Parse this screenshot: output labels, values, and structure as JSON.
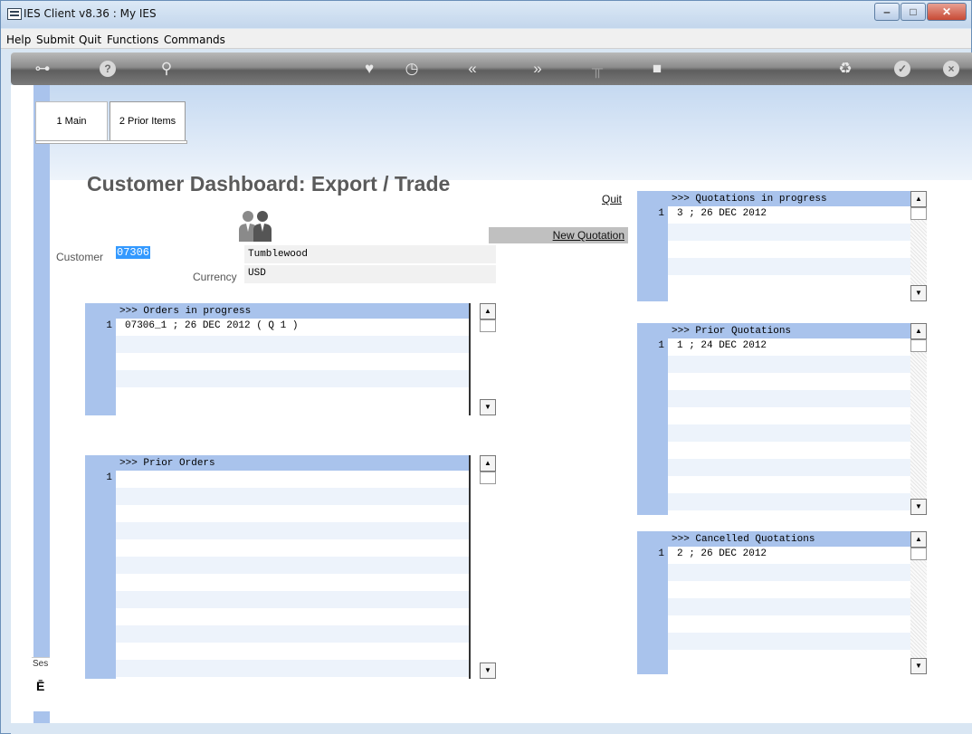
{
  "window": {
    "title": "IES Client v8.36 : My IES"
  },
  "menu": [
    "Help",
    "Submit",
    "Quit",
    "Functions",
    "Commands"
  ],
  "toolbar": {
    "icons": [
      "key-icon",
      "help-icon",
      "search-icon",
      "heart-icon",
      "clock-icon",
      "prev-icon",
      "next-icon",
      "tools-icon",
      "stop-icon",
      "recycle-icon",
      "check-icon",
      "close-icon"
    ]
  },
  "tabs": [
    {
      "label": "1 Main"
    },
    {
      "label": "2 Prior Items"
    }
  ],
  "page": {
    "title": "Customer Dashboard: Export / Trade"
  },
  "customer": {
    "label": "Customer",
    "code": "07306",
    "name": "Tumblewood",
    "currency_label": "Currency",
    "currency": "USD"
  },
  "actions": {
    "quit": "Quit",
    "new_quotation": "New Quotation"
  },
  "orders_in_progress": {
    "header": ">>> Orders in progress",
    "rows": [
      {
        "num": "1",
        "text": "07306_1 ; 26 DEC 2012 ( Q 1 )"
      }
    ]
  },
  "prior_orders": {
    "header": ">>> Prior Orders",
    "rows": [
      {
        "num": "1",
        "text": ""
      }
    ]
  },
  "quotations_in_progress": {
    "header": ">>> Quotations in progress",
    "rows": [
      {
        "num": "1",
        "text": "3 ; 26 DEC 2012"
      }
    ]
  },
  "prior_quotations": {
    "header": ">>> Prior Quotations",
    "rows": [
      {
        "num": "1",
        "text": "1 ; 24 DEC 2012"
      }
    ]
  },
  "cancelled_quotations": {
    "header": ">>> Cancelled Quotations",
    "rows": [
      {
        "num": "1",
        "text": "2 ; 26 DEC 2012"
      }
    ]
  },
  "session": {
    "label": "Ses"
  }
}
